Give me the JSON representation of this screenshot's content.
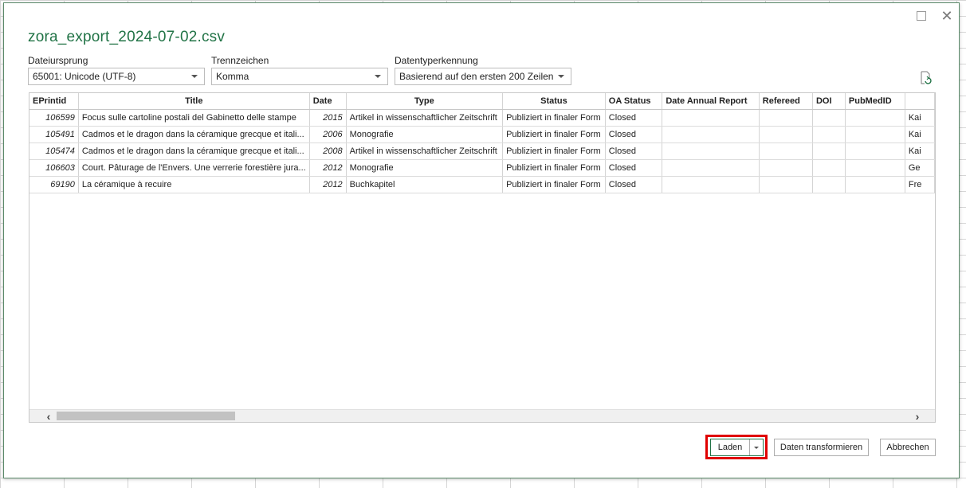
{
  "dialog": {
    "title": "zora_export_2024-07-02.csv"
  },
  "options": {
    "origin": {
      "label": "Dateiursprung",
      "value": "65001: Unicode (UTF-8)"
    },
    "delimiter": {
      "label": "Trennzeichen",
      "value": "Komma"
    },
    "type_detection": {
      "label": "Datentyperkennung",
      "value": "Basierend auf den ersten 200 Zeilen"
    }
  },
  "table": {
    "columns": [
      "EPrintid",
      "Title",
      "Date",
      "Type",
      "Status",
      "OA Status",
      "Date Annual Report",
      "Refereed",
      "DOI",
      "PubMedID",
      ""
    ],
    "rows": [
      [
        "106599",
        "Focus sulle cartoline postali del Gabinetto delle stampe",
        "2015",
        "Artikel in wissenschaftlicher Zeitschrift",
        "Publiziert in finaler Form",
        "Closed",
        "",
        "",
        "",
        "",
        "Kai"
      ],
      [
        "105491",
        "Cadmos et le dragon dans la céramique grecque et itali...",
        "2006",
        "Monografie",
        "Publiziert in finaler Form",
        "Closed",
        "",
        "",
        "",
        "",
        "Kai"
      ],
      [
        "105474",
        "Cadmos et le dragon dans la céramique grecque et itali...",
        "2008",
        "Artikel in wissenschaftlicher Zeitschrift",
        "Publiziert in finaler Form",
        "Closed",
        "",
        "",
        "",
        "",
        "Kai"
      ],
      [
        "106603",
        "Court. Pâturage de l'Envers. Une verrerie forestière jura...",
        "2012",
        "Monografie",
        "Publiziert in finaler Form",
        "Closed",
        "",
        "",
        "",
        "",
        "Ge"
      ],
      [
        "69190",
        "La céramique à recuire",
        "2012",
        "Buchkapitel",
        "Publiziert in finaler Form",
        "Closed",
        "",
        "",
        "",
        "",
        "Fre"
      ]
    ]
  },
  "buttons": {
    "load": "Laden",
    "transform": "Daten transformieren",
    "cancel": "Abbrechen"
  },
  "icons": {
    "maximize": "maximize-icon",
    "close": "close-icon",
    "refresh": "refresh-icon",
    "scroll_left": "chevron-left-icon",
    "scroll_right": "chevron-right-icon"
  },
  "colors": {
    "accent": "#217346",
    "highlight": "#e00000"
  }
}
